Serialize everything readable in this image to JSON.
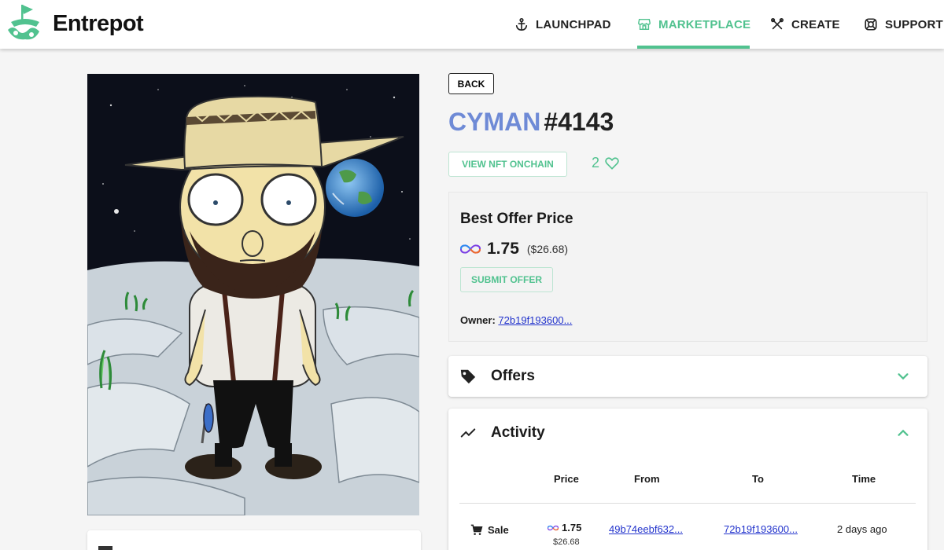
{
  "header": {
    "brand": "Entrepot",
    "nav": [
      {
        "label": "LAUNCHPAD",
        "icon": "anchor-icon"
      },
      {
        "label": "MARKETPLACE",
        "icon": "store-icon",
        "active": true
      },
      {
        "label": "CREATE",
        "icon": "tools-icon"
      },
      {
        "label": "SUPPORT",
        "icon": "lifebuoy-icon"
      }
    ]
  },
  "colors": {
    "accent": "#51c28f",
    "collection": "#6e8ad6",
    "link": "#2233cc"
  },
  "nft": {
    "back_label": "BACK",
    "collection": "CYMAN",
    "number": "#4143",
    "view_onchain_label": "VIEW NFT ONCHAIN",
    "like_count": "2"
  },
  "offer": {
    "label": "Best Offer Price",
    "price": "1.75",
    "usd": "($26.68)",
    "submit_label": "SUBMIT OFFER",
    "owner_label": "Owner:",
    "owner_value": "72b19f193600..."
  },
  "offers_section": {
    "title": "Offers"
  },
  "activity": {
    "title": "Activity",
    "columns": [
      "Price",
      "From",
      "To",
      "Time"
    ],
    "rows": [
      {
        "type": "Sale",
        "price": "1.75",
        "usd": "$26.68",
        "from": "49b74eebf632...",
        "to": "72b19f193600...",
        "time": "2 days ago"
      }
    ]
  }
}
